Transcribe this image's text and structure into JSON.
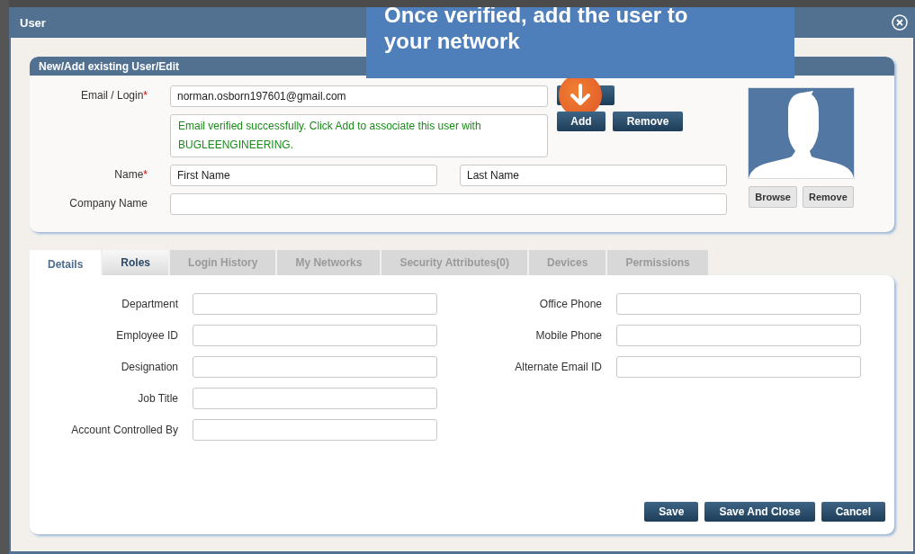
{
  "window": {
    "title": "User"
  },
  "callout": {
    "lines": [
      "Once verified, add the user to",
      "your network"
    ]
  },
  "user_panel": {
    "title": "New/Add existing User/Edit",
    "required_mark": "*",
    "email": {
      "label": "Email / Login",
      "required": true,
      "value": "norman.osborn197601@gmail.com"
    },
    "message": "Email verified successfully. Click Add to associate this user with BUGLEENGINEERING.",
    "email_buttons": [
      "Add",
      "Remove"
    ],
    "name": {
      "label": "Name",
      "required": true,
      "first_placeholder": "First Name",
      "last_placeholder": "Last Name"
    },
    "company": {
      "label": "Company Name",
      "required": false
    },
    "photo_buttons": [
      "Browse",
      "Remove"
    ]
  },
  "tabs": [
    {
      "label": "Details",
      "selected": true,
      "disabled": false
    },
    {
      "label": "Roles",
      "selected": false,
      "disabled": false
    },
    {
      "label": "Login History",
      "selected": false,
      "disabled": true
    },
    {
      "label": "My Networks",
      "selected": false,
      "disabled": true
    },
    {
      "label": "Security Attributes(0)",
      "selected": false,
      "disabled": true
    },
    {
      "label": "Devices",
      "selected": false,
      "disabled": true
    },
    {
      "label": "Permissions",
      "selected": false,
      "disabled": true
    }
  ],
  "details": {
    "left": [
      {
        "label": "Department"
      },
      {
        "label": "Employee ID"
      },
      {
        "label": "Designation"
      },
      {
        "label": "Job Title"
      },
      {
        "label": "Account Controlled By"
      }
    ],
    "right": [
      {
        "label": "Office Phone"
      },
      {
        "label": "Mobile Phone"
      },
      {
        "label": "Alternate Email ID"
      }
    ]
  },
  "footer_buttons": [
    "Save",
    "Save And Close",
    "Cancel"
  ]
}
